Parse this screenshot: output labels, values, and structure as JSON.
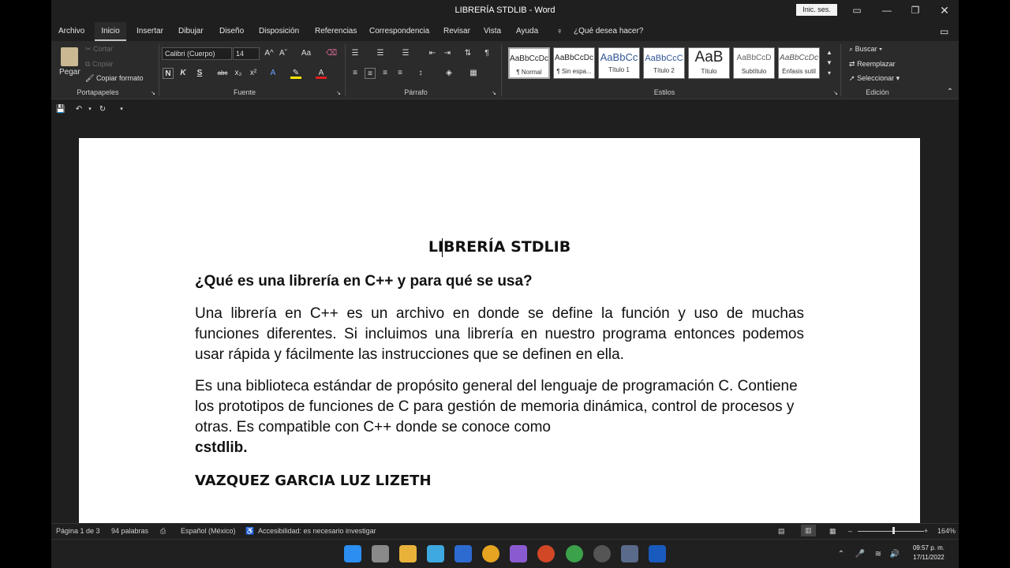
{
  "window": {
    "title": "LIBRERÍA STDLIB  -  Word",
    "signin": "Inic. ses."
  },
  "tabs": [
    "Archivo",
    "Inicio",
    "Insertar",
    "Dibujar",
    "Diseño",
    "Disposición",
    "Referencias",
    "Correspondencia",
    "Revisar",
    "Vista",
    "Ayuda"
  ],
  "tell_me": "¿Qué desea hacer?",
  "clipboard": {
    "paste": "Pegar",
    "cut": "Cortar",
    "copy": "Copiar",
    "format_painter": "Copiar formato",
    "label": "Portapapeles"
  },
  "font": {
    "name": "Calibri (Cuerpo)",
    "size": "14",
    "bold": "N",
    "italic": "K",
    "underline": "S",
    "strike": "abc",
    "sub": "x₂",
    "sup": "x²",
    "case": "Aa",
    "grow": "A^",
    "shrink": "Aˇ",
    "label": "Fuente"
  },
  "paragraph": {
    "label": "Párrafo",
    "pilcrow": "¶"
  },
  "styles": {
    "label": "Estilos",
    "items": [
      {
        "preview": "AaBbCcDc",
        "name": "¶ Normal"
      },
      {
        "preview": "AaBbCcDc",
        "name": "¶ Sin espa..."
      },
      {
        "preview": "AaBbCc",
        "name": "Título 1"
      },
      {
        "preview": "AaBbCcC",
        "name": "Título 2"
      },
      {
        "preview": "AaB",
        "name": "Título"
      },
      {
        "preview": "AaBbCcD",
        "name": "Subtítulo"
      },
      {
        "preview": "AaBbCcDc",
        "name": "Énfasis sutil"
      }
    ]
  },
  "editing": {
    "find": "Buscar",
    "replace": "Reemplazar",
    "select": "Seleccionar",
    "label": "Edición"
  },
  "document": {
    "title": "LIBRERÍA STDLIB",
    "heading": "¿Qué es una librería en C++ y para qué se usa?",
    "p1": "Una librería en C++ es un archivo en donde se define la función y uso de muchas funciones diferentes. Si incluimos una librería en nuestro programa entonces podemos usar rápida y fácilmente las instrucciones que se definen en ella.",
    "p2": "Es una biblioteca estándar de propósito general del lenguaje de programación C. Contiene los prototipos de funciones de C para gestión de memoria dinámica, control de procesos y otras. Es compatible con C++ donde se conoce como",
    "p2_bold": "cstdlib.",
    "author": "VAZQUEZ GARCIA LUZ LIZETH"
  },
  "status": {
    "page": "Página 1 de 3",
    "words": "94 palabras",
    "language": "Español (México)",
    "accessibility": "Accesibilidad: es necesario investigar",
    "zoom": "164%"
  },
  "taskbar": {
    "time": "09:57 p. m.",
    "date": "17/11/2022"
  },
  "colors": {
    "bg": "#1f1f1f",
    "ribbon": "#2b2b2b",
    "page": "#ffffff",
    "word_blue": "#185abd"
  }
}
